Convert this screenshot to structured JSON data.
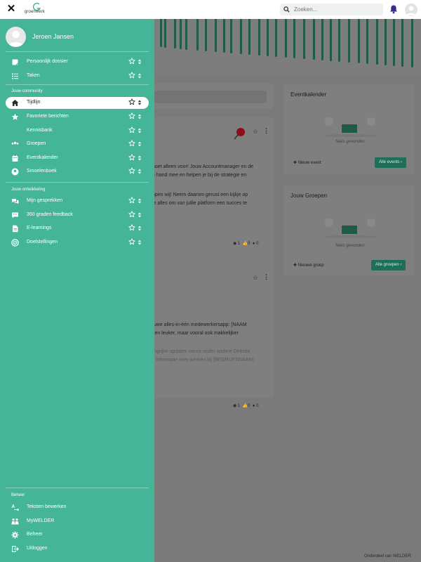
{
  "topbar": {
    "logo_text": "groenwerk",
    "search_placeholder": "Zoeken...",
    "close_icon": "close-icon",
    "bell_color": "#3b2a8f"
  },
  "sidebar": {
    "background": "#44b596",
    "user_name": "Jeroen Jansen",
    "personal": [
      {
        "label": "Persoonlijk dossier",
        "icon": "notes-icon"
      },
      {
        "label": "Taken",
        "icon": "tasks-icon"
      }
    ],
    "community": {
      "title": "Jouw community",
      "items": [
        {
          "label": "Tijdlijn",
          "icon": "home-icon",
          "active": true
        },
        {
          "label": "Favoriete berichten",
          "icon": "star-icon"
        },
        {
          "label": "Kennisbank",
          "icon": "book-icon"
        },
        {
          "label": "Groepen",
          "icon": "group-icon"
        },
        {
          "label": "Eventkalender",
          "icon": "calendar-icon"
        },
        {
          "label": "Smoelenboek",
          "icon": "user-circle-icon"
        }
      ]
    },
    "development": {
      "title": "Jouw ontwikkeling",
      "items": [
        {
          "label": "Mijn gesprekken",
          "icon": "chat-icon"
        },
        {
          "label": "360 graden feedback",
          "icon": "feedback-icon"
        },
        {
          "label": "E-learnings",
          "icon": "document-icon"
        },
        {
          "label": "Doelstellingen",
          "icon": "target-icon"
        }
      ]
    },
    "admin": {
      "title": "Beheer",
      "items": [
        {
          "label": "Teksten bewerken",
          "icon": "text-edit-icon"
        },
        {
          "label": "MyWELDER",
          "icon": "people-icon"
        },
        {
          "label": "Beheer",
          "icon": "gear-icon"
        },
        {
          "label": "Uitloggen",
          "icon": "logout-icon"
        }
      ]
    }
  },
  "background": {
    "post1": {
      "line1": "hoet alleen voor! Jouw Accountmanager en de",
      "line2": "e hand mee en helpen je bij de strategie en",
      "line3": "ppen wij! Neem daarom gerust een kijkje op",
      "line4": "je alles om van jullie platform een succes te",
      "stats": {
        "views": "1",
        "likes": "0",
        "comments": "0"
      }
    },
    "post2": {
      "line1": "euwe alles-in-één medewerkersapp: [NAAM",
      "line2": "leen leuker, maar vooral ook makkelijker",
      "line3": "angrijke updates vanuit onder andere Directie,",
      "line4": "le informatie over werken bij [BEDRIJFSNAAM]",
      "stats": {
        "views": "1",
        "likes": "0",
        "comments": "0"
      }
    },
    "events_card": {
      "title": "Eventkalender",
      "empty": "Niets gevonden",
      "new_label": "Nieuw event",
      "all_label": "Alle events"
    },
    "groups_card": {
      "title": "Jouw Groepen",
      "empty": "Niets gevonden",
      "new_label": "Nieuwe groep",
      "all_label": "Alle groepen"
    },
    "footer": "Onderdeel van WELDER"
  }
}
